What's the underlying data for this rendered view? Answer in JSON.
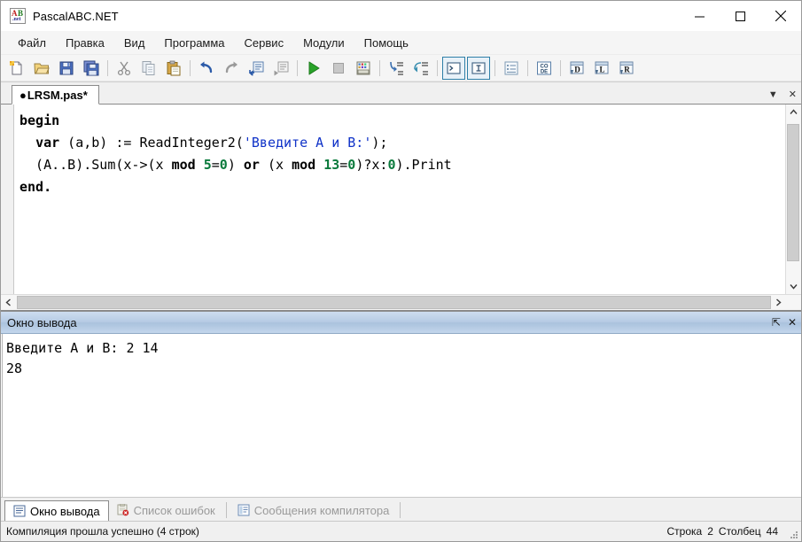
{
  "window": {
    "title": "PascalABC.NET",
    "logo_a": "A",
    "logo_b": "B",
    "logo_net": ".net",
    "minimize_label": "minimize",
    "maximize_label": "maximize",
    "close_label": "close"
  },
  "menu": {
    "items": [
      {
        "label": "Файл"
      },
      {
        "label": "Правка"
      },
      {
        "label": "Вид"
      },
      {
        "label": "Программа"
      },
      {
        "label": "Сервис"
      },
      {
        "label": "Модули"
      },
      {
        "label": "Помощь"
      }
    ]
  },
  "toolbar": {
    "buttons": [
      {
        "name": "new-file-icon",
        "title": "Новый"
      },
      {
        "name": "open-file-icon",
        "title": "Открыть"
      },
      {
        "name": "save-file-icon",
        "title": "Сохранить"
      },
      {
        "name": "save-all-icon",
        "title": "Сохранить все"
      },
      {
        "name": "cut-icon",
        "title": "Вырезать"
      },
      {
        "name": "copy-icon",
        "title": "Копировать"
      },
      {
        "name": "paste-icon",
        "title": "Вставить"
      },
      {
        "name": "undo-icon",
        "title": "Отменить"
      },
      {
        "name": "redo-icon",
        "title": "Вернуть"
      },
      {
        "name": "comment-icon",
        "title": "Закомментировать"
      },
      {
        "name": "uncomment-icon",
        "title": "Раскомментировать"
      },
      {
        "name": "run-icon",
        "title": "Выполнить"
      },
      {
        "name": "stop-icon",
        "title": "Стоп"
      },
      {
        "name": "build-icon",
        "title": "Компилировать"
      },
      {
        "name": "step-into-icon",
        "title": "Шаг внутрь"
      },
      {
        "name": "step-over-icon",
        "title": "Шаг через"
      },
      {
        "name": "console-window-icon",
        "title": "Окно вывода",
        "pressed": true
      },
      {
        "name": "input-cursor-icon",
        "title": "Ввод",
        "pressed": true
      },
      {
        "name": "list-icon",
        "title": "Список"
      },
      {
        "name": "code-icon",
        "title": "CODE",
        "text": "CO\nDE"
      },
      {
        "name": "debug-d-icon",
        "title": "D",
        "text": "D"
      },
      {
        "name": "debug-l-icon",
        "title": "L",
        "text": "L"
      },
      {
        "name": "debug-r-icon",
        "title": "R",
        "text": "R"
      }
    ]
  },
  "editor": {
    "tab": {
      "dot": "●",
      "filename": "LRSM.pas*"
    },
    "tabstrip_menu": "▼",
    "tabstrip_close": "✕",
    "code_lines": [
      [
        {
          "t": "begin",
          "c": "kw"
        }
      ],
      [
        {
          "t": "  "
        },
        {
          "t": "var",
          "c": "kw"
        },
        {
          "t": " (a,b) := ReadInteger2("
        },
        {
          "t": "'Введите А и В:'",
          "c": "str"
        },
        {
          "t": ");"
        }
      ],
      [
        {
          "t": "  (A..B).Sum(x->(x "
        },
        {
          "t": "mod",
          "c": "kw"
        },
        {
          "t": " "
        },
        {
          "t": "5",
          "c": "num"
        },
        {
          "t": "="
        },
        {
          "t": "0",
          "c": "num"
        },
        {
          "t": ") "
        },
        {
          "t": "or",
          "c": "kw"
        },
        {
          "t": " (x "
        },
        {
          "t": "mod",
          "c": "kw"
        },
        {
          "t": " "
        },
        {
          "t": "13",
          "c": "num"
        },
        {
          "t": "="
        },
        {
          "t": "0",
          "c": "num"
        },
        {
          "t": ")?x:"
        },
        {
          "t": "0",
          "c": "num"
        },
        {
          "t": ").Print"
        }
      ],
      [
        {
          "t": "end.",
          "c": "kw"
        }
      ]
    ]
  },
  "output": {
    "header_title": "Окно вывода",
    "pin_icon": "⇱",
    "close_icon": "✕",
    "text": "Введите А и В: 2 14\n28"
  },
  "bottom_tabs": [
    {
      "label": "Окно вывода",
      "icon": "output-window-icon",
      "active": true
    },
    {
      "label": "Список ошибок",
      "icon": "error-list-icon",
      "active": false
    },
    {
      "label": "Сообщения компилятора",
      "icon": "compiler-messages-icon",
      "active": false
    }
  ],
  "status": {
    "message": "Компиляция прошла успешно (4 строк)",
    "line_label": "Строка",
    "line_value": "2",
    "column_label": "Столбец",
    "column_value": "44"
  },
  "colors": {
    "accent_pressed_border": "#2e7fa8",
    "string_literal": "#1033c8",
    "number_literal": "#0a7a3c",
    "output_header_blue": "#b6cbe4"
  }
}
